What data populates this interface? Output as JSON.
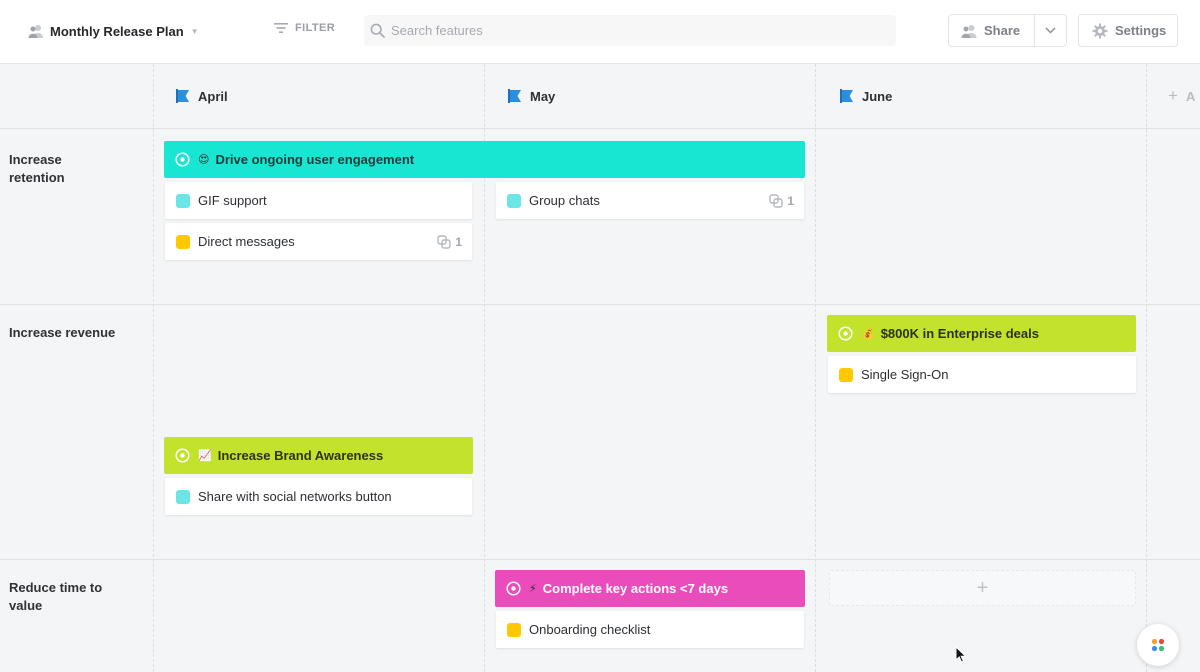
{
  "topbar": {
    "plan_title": "Monthly Release Plan",
    "filter_label": "FILTER",
    "search_placeholder": "Search features",
    "search_value": "",
    "share_label": "Share",
    "settings_label": "Settings"
  },
  "columns": [
    {
      "label": "April",
      "flag_color": "#2b8fe0"
    },
    {
      "label": "May",
      "flag_color": "#2b8fe0"
    },
    {
      "label": "June",
      "flag_color": "#2b8fe0"
    }
  ],
  "add_column_label": "A",
  "rows": [
    {
      "label": "Increase retention"
    },
    {
      "label": "Increase revenue"
    },
    {
      "label": "Reduce time to value"
    }
  ],
  "epics": {
    "engagement": {
      "emoji": "😍",
      "title": "Drive ongoing user engagement",
      "color": "#18e6d2",
      "text_color": "#1d3b3a"
    },
    "enterprise": {
      "emoji": "💰",
      "title": "$800K in Enterprise deals",
      "color": "#c2e22b",
      "text_color": "#2b3313"
    },
    "brand": {
      "emoji": "📈",
      "title": "Increase Brand Awareness",
      "color": "#c2e22b",
      "text_color": "#2b3313"
    },
    "actions": {
      "emoji": "⚡",
      "title": "Complete key actions <7 days",
      "color": "#ea4cbc",
      "text_color": "#ffffff"
    }
  },
  "cards": {
    "gif": {
      "title": "GIF support",
      "color": "#6be6e6"
    },
    "group_chats": {
      "title": "Group chats",
      "color": "#6be6e6",
      "link_count": "1"
    },
    "direct_messages": {
      "title": "Direct messages",
      "color": "#ffc800",
      "link_count": "1"
    },
    "sso": {
      "title": "Single Sign-On",
      "color": "#ffc800"
    },
    "share_social": {
      "title": "Share with social networks button",
      "color": "#6be6e6"
    },
    "onboarding": {
      "title": "Onboarding checklist",
      "color": "#ffc800"
    }
  },
  "colors": {
    "background": "#f4f5f6",
    "accent_blue": "#2b8fe0"
  }
}
